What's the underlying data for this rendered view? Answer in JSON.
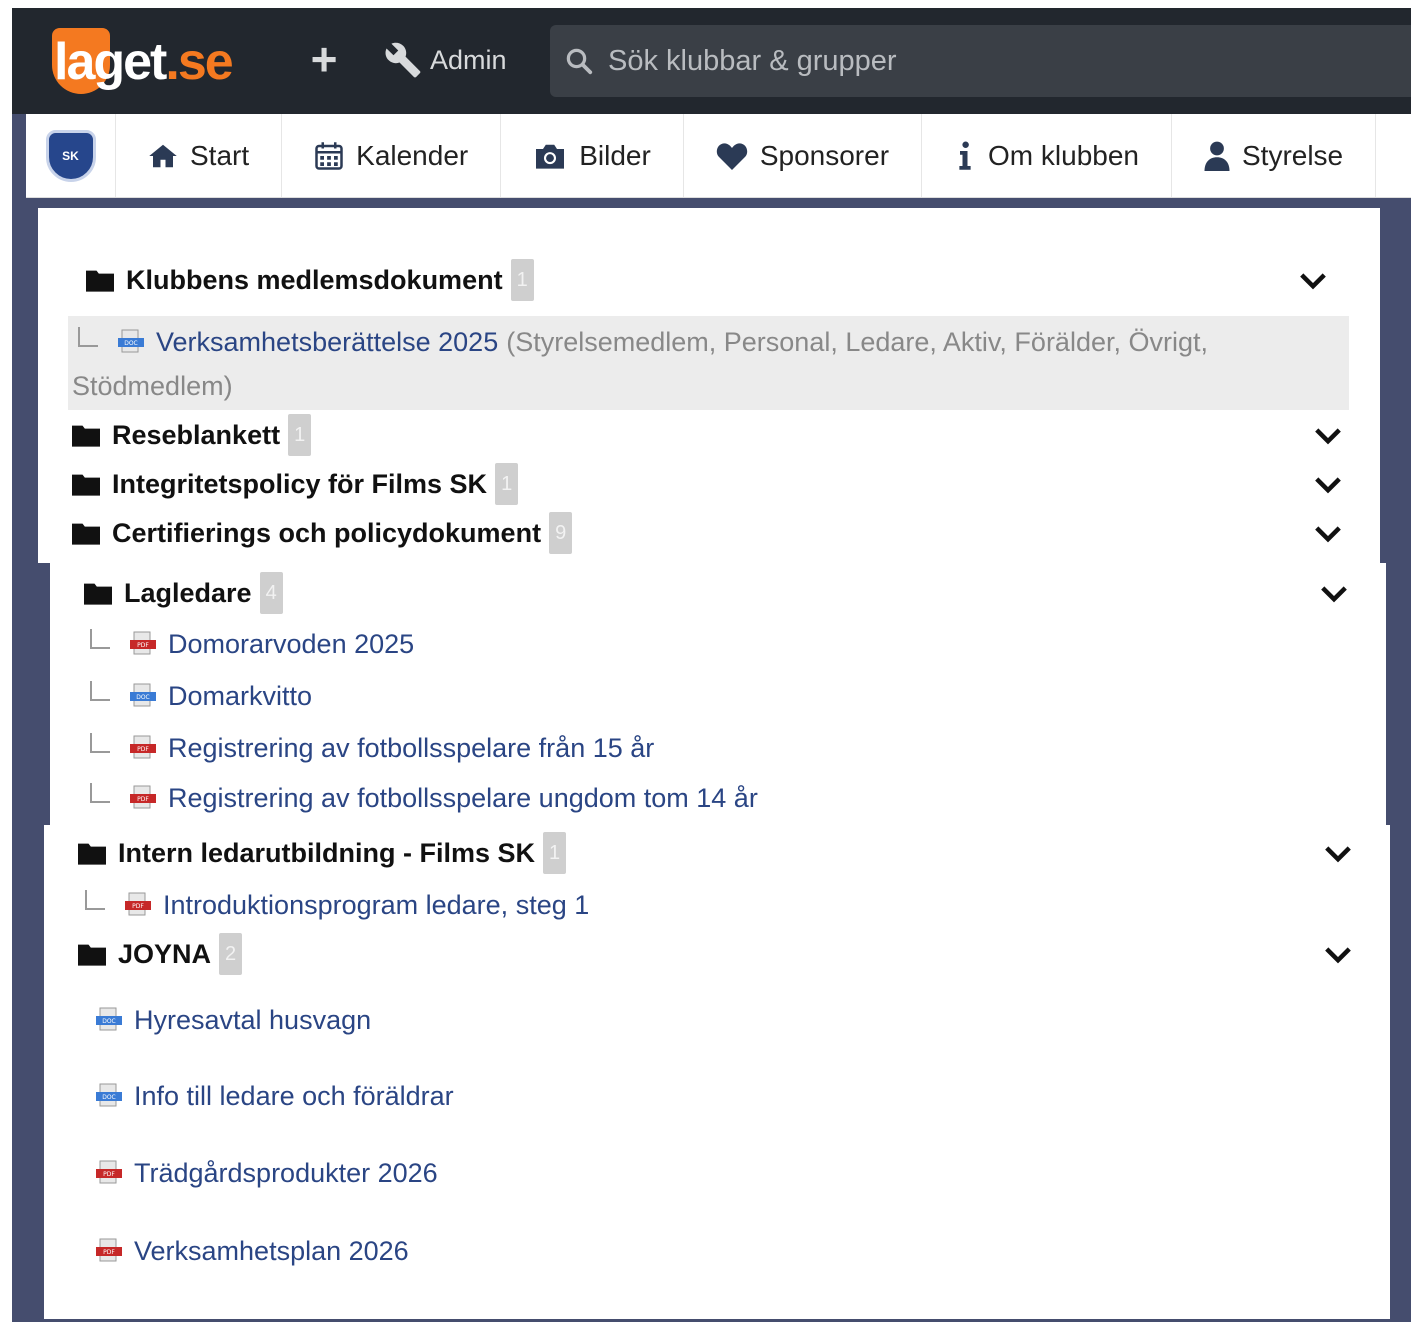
{
  "topbar": {
    "logo_text_main": "laget",
    "logo_text_suffix": ".se",
    "admin_label": "Admin",
    "search_placeholder": "Sök klubbar & grupper"
  },
  "club": {
    "crest_text": "SK"
  },
  "nav": [
    {
      "label": "Start",
      "icon": "home-icon"
    },
    {
      "label": "Kalender",
      "icon": "calendar-icon"
    },
    {
      "label": "Bilder",
      "icon": "camera-icon"
    },
    {
      "label": "Sponsorer",
      "icon": "heart-icon"
    },
    {
      "label": "Om klubben",
      "icon": "info-icon"
    },
    {
      "label": "Styrelse",
      "icon": "user-icon"
    }
  ],
  "folders": [
    {
      "name": "Klubbens medlemsdokument",
      "count": "1",
      "docs": [
        {
          "title": "Verksamhetsberättelse 2025",
          "type": "doc",
          "roles_line1": "(Styrelsemedlem, Personal, Ledare, Aktiv, Förälder, Övrigt,",
          "roles_line2": "Stödmedlem)"
        }
      ]
    },
    {
      "name": "Reseblankett",
      "count": "1",
      "docs": []
    },
    {
      "name": "Integritetspolicy för Films SK",
      "count": "1",
      "docs": []
    },
    {
      "name": "Certifierings och policydokument",
      "count": "9",
      "docs": []
    },
    {
      "name": "Lagledare",
      "count": "4",
      "docs": [
        {
          "title": "Domorarvoden 2025",
          "type": "pdf"
        },
        {
          "title": "Domarkvitto",
          "type": "doc"
        },
        {
          "title": "Registrering av fotbollsspelare från 15 år",
          "type": "pdf"
        },
        {
          "title": "Registrering av fotbollsspelare ungdom tom 14 år",
          "type": "pdf"
        }
      ]
    },
    {
      "name": "Intern ledarutbildning - Films SK",
      "count": "1",
      "docs": [
        {
          "title": "Introduktionsprogram ledare, steg 1",
          "type": "pdf"
        }
      ]
    },
    {
      "name": "JOYNA",
      "count": "2",
      "docs": [
        {
          "title": "Hyresavtal husvagn",
          "type": "doc"
        },
        {
          "title": "Info till ledare och föräldrar",
          "type": "doc"
        },
        {
          "title": "Trädgårdsprodukter 2026",
          "type": "pdf"
        },
        {
          "title": "Verksamhetsplan 2026",
          "type": "pdf"
        }
      ]
    }
  ],
  "colors": {
    "accent": "#f47920",
    "link": "#2a4584",
    "topbar": "#22272e",
    "frame": "#454d6e"
  }
}
